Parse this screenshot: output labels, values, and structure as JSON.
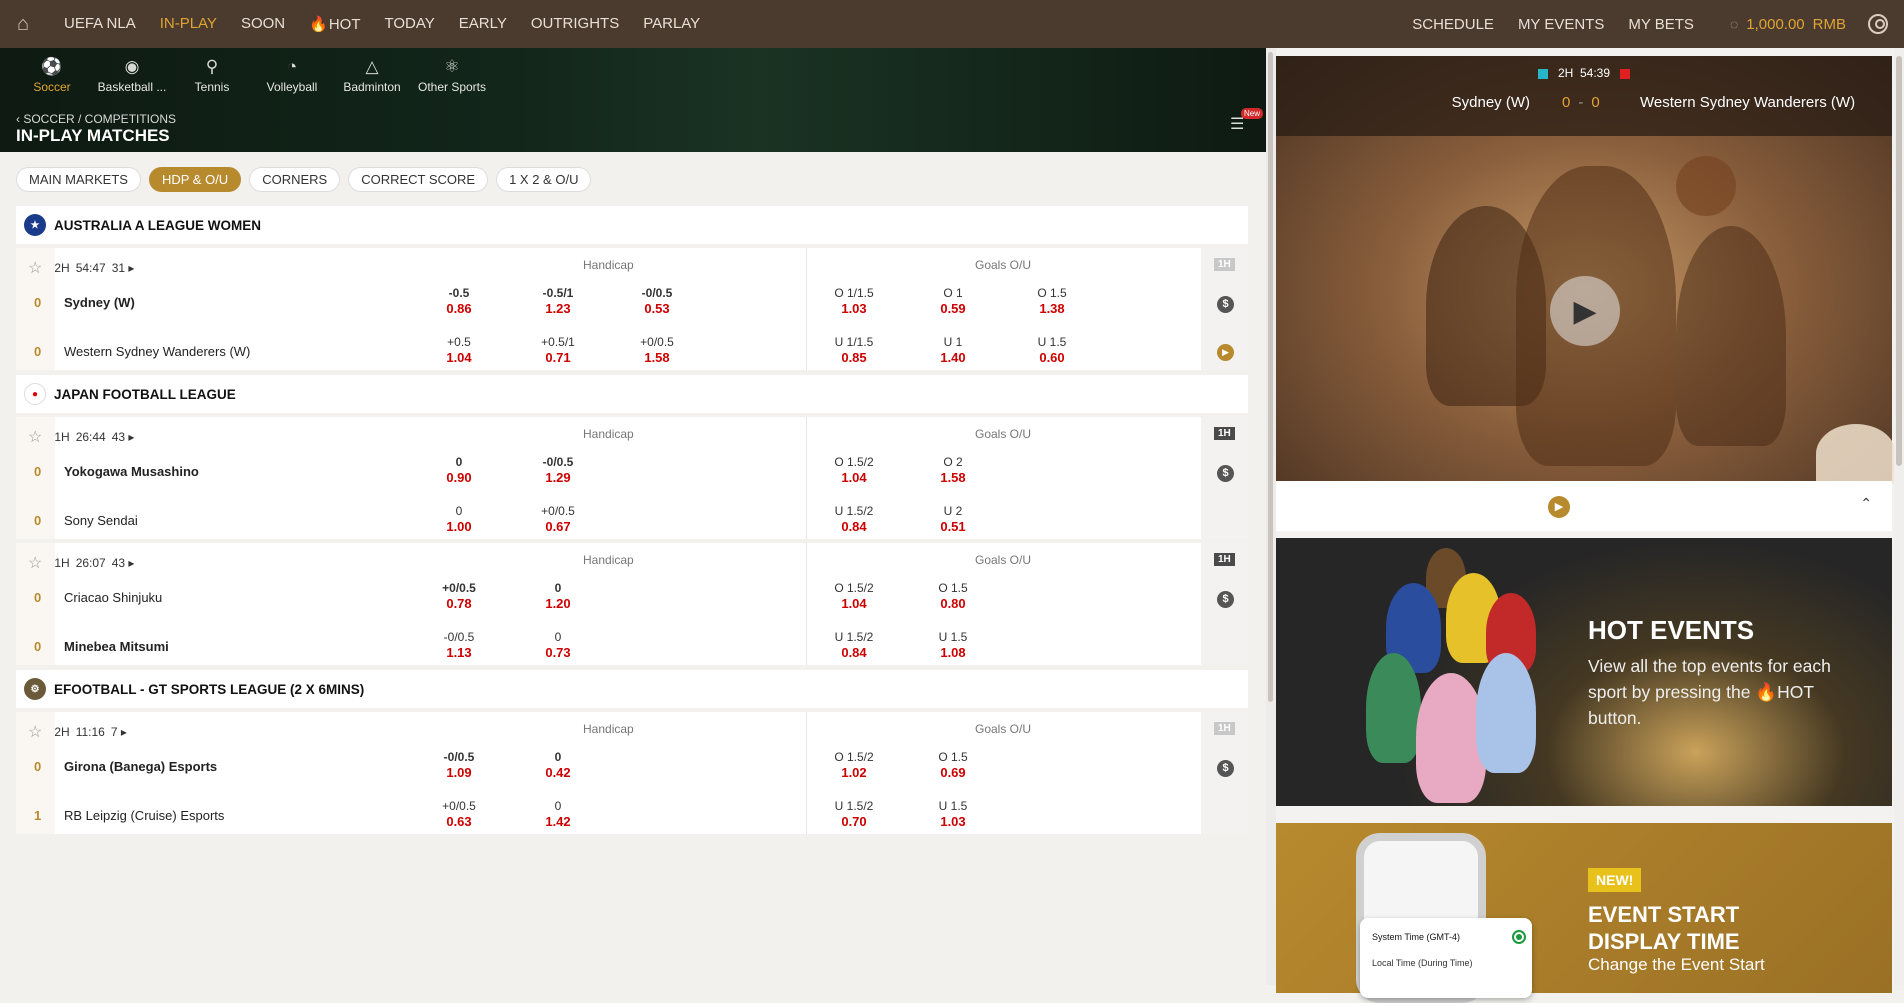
{
  "topnav": {
    "items": [
      "UEFA NLA",
      "IN-PLAY",
      "SOON",
      "HOT",
      "TODAY",
      "EARLY",
      "OUTRIGHTS",
      "PARLAY"
    ],
    "right": [
      "SCHEDULE",
      "MY EVENTS",
      "MY BETS"
    ],
    "balance": "1,000.00",
    "currency": "RMB",
    "accent": "#e0a434"
  },
  "sports": [
    "Soccer",
    "Basketball ...",
    "Tennis",
    "Volleyball",
    "Badminton",
    "Other Sports"
  ],
  "breadcrumb": "SOCCER / COMPETITIONS",
  "page_title": "IN-PLAY MATCHES",
  "new_badge": "New",
  "market_tabs": [
    "MAIN MARKETS",
    "HDP & O/U",
    "CORNERS",
    "CORRECT SCORE",
    "1 X 2 & O/U"
  ],
  "labels": {
    "handicap": "Handicap",
    "goals": "Goals O/U"
  },
  "leagues": [
    {
      "name": "AUSTRALIA A LEAGUE WOMEN",
      "matches": [
        {
          "period": "2H",
          "clock": "54:47",
          "markets": "31",
          "phase": "1H",
          "home": {
            "name": "Sydney (W)",
            "score": "0",
            "hdp": [
              [
                "-0.5",
                "0.86"
              ],
              [
                "-0.5/1",
                "1.23"
              ],
              [
                "-0/0.5",
                "0.53"
              ]
            ],
            "ou": [
              [
                "O 1/1.5",
                "1.03"
              ],
              [
                "O 1",
                "0.59"
              ],
              [
                "O 1.5",
                "1.38"
              ]
            ]
          },
          "away": {
            "name": "Western Sydney Wanderers (W)",
            "score": "0",
            "hdp": [
              [
                "+0.5",
                "1.04"
              ],
              [
                "+0.5/1",
                "0.71"
              ],
              [
                "+0/0.5",
                "1.58"
              ]
            ],
            "ou": [
              [
                "U 1/1.5",
                "0.85"
              ],
              [
                "U 1",
                "1.40"
              ],
              [
                "U 1.5",
                "0.60"
              ]
            ]
          }
        }
      ]
    },
    {
      "name": "JAPAN FOOTBALL LEAGUE",
      "matches": [
        {
          "period": "1H",
          "clock": "26:44",
          "markets": "43",
          "phase": "1H",
          "home": {
            "name": "Yokogawa Musashino",
            "score": "0",
            "hdp": [
              [
                "0",
                "0.90"
              ],
              [
                "-0/0.5",
                "1.29"
              ]
            ],
            "ou": [
              [
                "O 1.5/2",
                "1.04"
              ],
              [
                "O 2",
                "1.58"
              ]
            ]
          },
          "away": {
            "name": "Sony Sendai",
            "score": "0",
            "hdp": [
              [
                "0",
                "1.00"
              ],
              [
                "+0/0.5",
                "0.67"
              ]
            ],
            "ou": [
              [
                "U 1.5/2",
                "0.84"
              ],
              [
                "U 2",
                "0.51"
              ]
            ]
          }
        },
        {
          "period": "1H",
          "clock": "26:07",
          "markets": "43",
          "phase": "1H",
          "home": {
            "name": "Criacao Shinjuku",
            "score": "0",
            "hdp": [
              [
                "+0/0.5",
                "0.78"
              ],
              [
                "0",
                "1.20"
              ]
            ],
            "ou": [
              [
                "O 1.5/2",
                "1.04"
              ],
              [
                "O 1.5",
                "0.80"
              ]
            ]
          },
          "away": {
            "name": "Minebea Mitsumi",
            "score": "0",
            "hdp": [
              [
                "-0/0.5",
                "1.13"
              ],
              [
                "0",
                "0.73"
              ]
            ],
            "ou": [
              [
                "U 1.5/2",
                "0.84"
              ],
              [
                "U 1.5",
                "1.08"
              ]
            ]
          }
        }
      ]
    },
    {
      "name": "EFOOTBALL - GT SPORTS LEAGUE (2 X 6MINS)",
      "matches": [
        {
          "period": "2H",
          "clock": "11:16",
          "markets": "7",
          "phase": "1H",
          "home": {
            "name": "Girona (Banega) Esports",
            "score": "0",
            "hdp": [
              [
                "-0/0.5",
                "1.09"
              ],
              [
                "0",
                "0.42"
              ]
            ],
            "ou": [
              [
                "O 1.5/2",
                "1.02"
              ],
              [
                "O 1.5",
                "0.69"
              ]
            ]
          },
          "away": {
            "name": "RB Leipzig (Cruise) Esports",
            "score": "1",
            "hdp": [
              [
                "+0/0.5",
                "0.63"
              ],
              [
                "0",
                "1.42"
              ]
            ],
            "ou": [
              [
                "U 1.5/2",
                "0.70"
              ],
              [
                "U 1.5",
                "1.03"
              ]
            ]
          }
        }
      ]
    }
  ],
  "video": {
    "period": "2H",
    "clock": "54:39",
    "home": "Sydney (W)",
    "away": "Western Sydney Wanderers (W)",
    "home_score": "0",
    "away_score": "0"
  },
  "hot_promo": {
    "title": "HOT EVENTS",
    "line1": "View all the top events for each sport by pressing",
    "line2_pre": "the",
    "line2_post": "HOT button."
  },
  "new_promo": {
    "tag": "NEW!",
    "title1": "EVENT START",
    "title2": "DISPLAY TIME",
    "desc": "Change the Event Start",
    "card_title": "System Time (GMT-4)",
    "card_sub": "Local Time (During Time)"
  }
}
